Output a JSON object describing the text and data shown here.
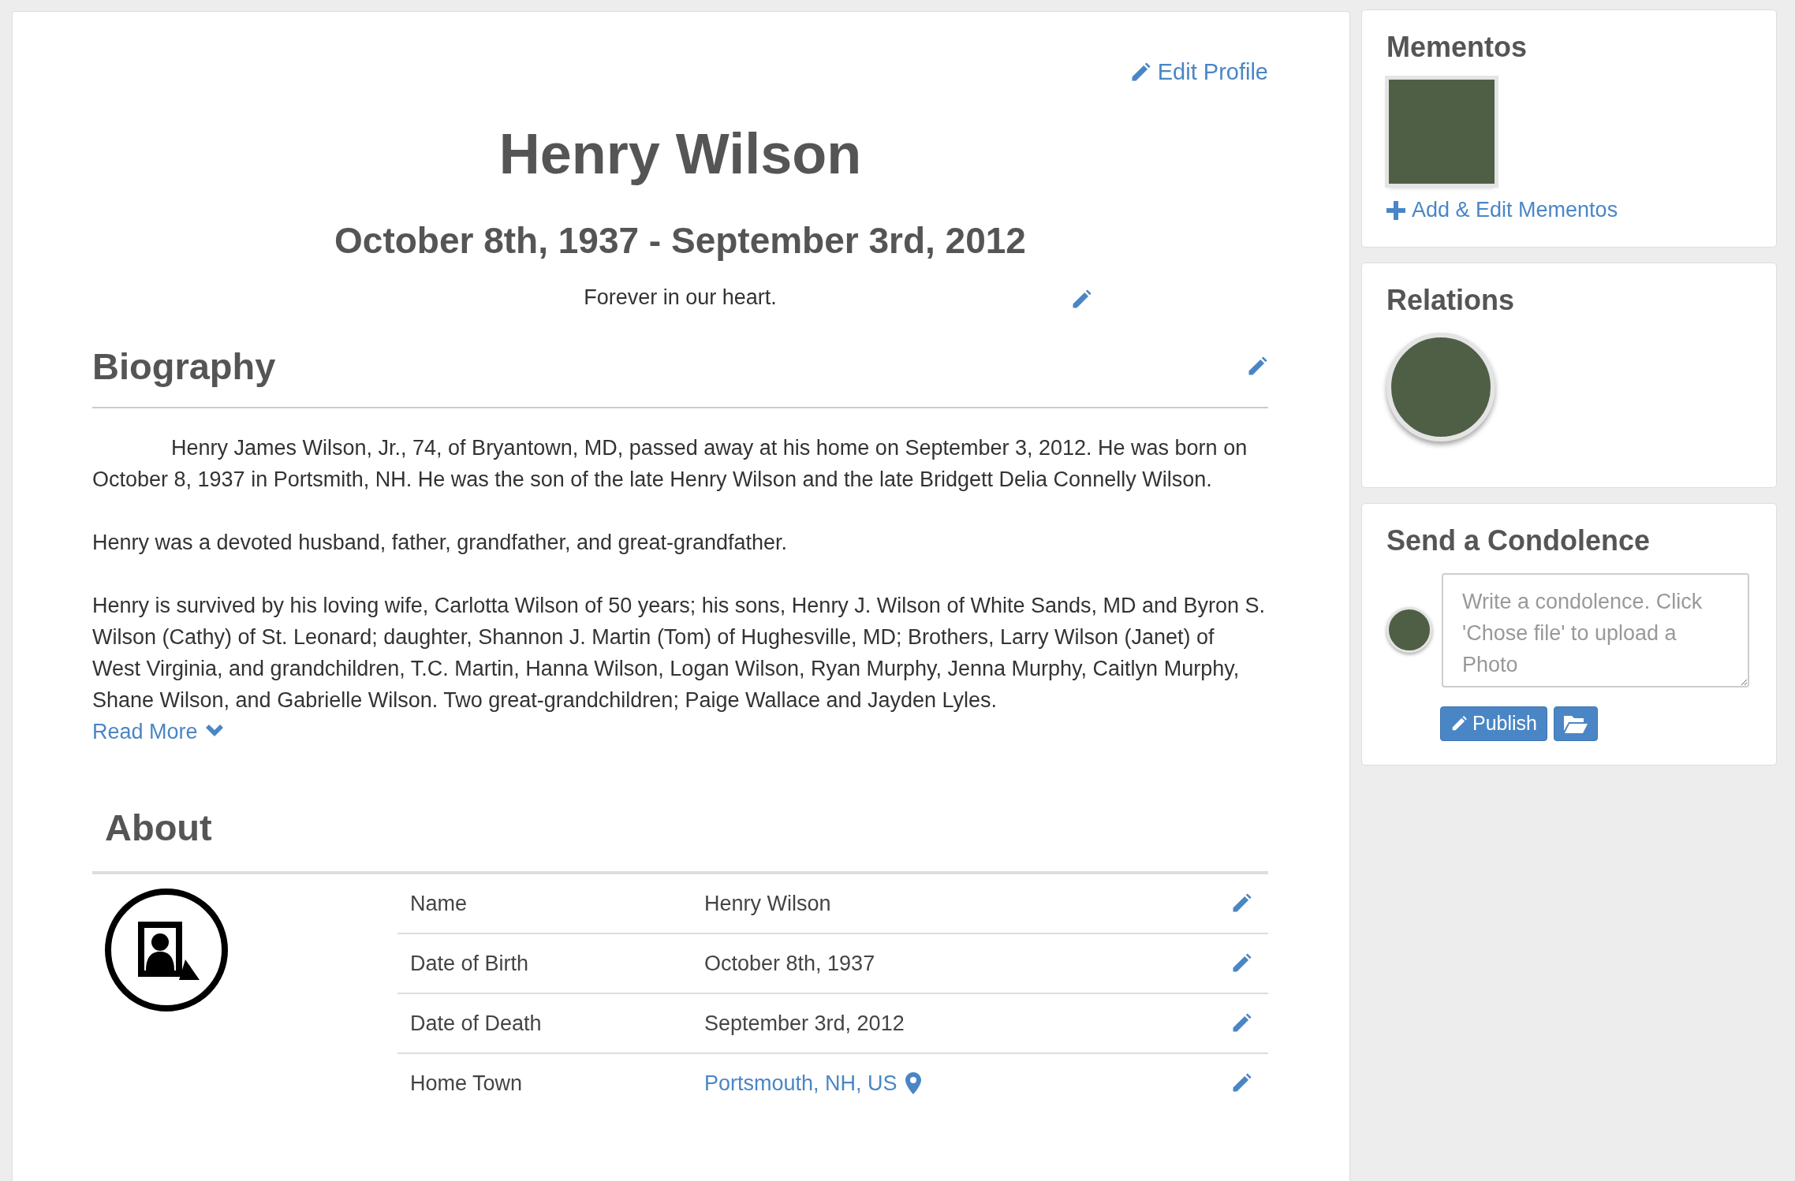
{
  "edit_profile": "Edit Profile",
  "name": "Henry Wilson",
  "dates": "October 8th, 1937 - September 3rd, 2012",
  "tagline": "Forever in our heart.",
  "biography": {
    "title": "Biography",
    "paragraphs": [
      "Henry James Wilson, Jr., 74, of Bryantown, MD, passed away at his home on September 3, 2012. He was born on October 8, 1937 in Portsmith, NH. He was the son of the late Henry Wilson and the late Bridgett Delia Connelly Wilson.",
      "Henry was a devoted husband, father, grandfather, and great-grandfather.",
      "Henry is survived by his loving wife, Carlotta Wilson of 50 years; his sons, Henry J. Wilson of White Sands, MD and Byron S. Wilson (Cathy) of St. Leonard; daughter, Shannon J. Martin (Tom) of Hughesville, MD; Brothers, Larry Wilson (Janet) of West Virginia, and grandchildren, T.C. Martin, Hanna Wilson, Logan Wilson, Ryan Murphy, Jenna Murphy, Caitlyn Murphy, Shane Wilson, and Gabrielle Wilson. Two great-grandchildren; Paige Wallace and Jayden Lyles."
    ],
    "read_more": "Read More"
  },
  "about": {
    "title": "About",
    "rows": [
      {
        "label": "Name",
        "value": "Henry Wilson",
        "kind": "text"
      },
      {
        "label": "Date of Birth",
        "value": "October 8th, 1937",
        "kind": "text"
      },
      {
        "label": "Date of Death",
        "value": "September 3rd, 2012",
        "kind": "text"
      },
      {
        "label": "Home Town",
        "value": "Portsmouth, NH, US",
        "kind": "location"
      }
    ]
  },
  "sidebar": {
    "mementos": {
      "title": "Mementos",
      "add_link": "Add & Edit Mementos"
    },
    "relations": {
      "title": "Relations"
    },
    "condolence": {
      "title": "Send a Condolence",
      "placeholder": "Write a condolence. Click 'Chose file' to upload a Photo",
      "publish": "Publish"
    }
  }
}
